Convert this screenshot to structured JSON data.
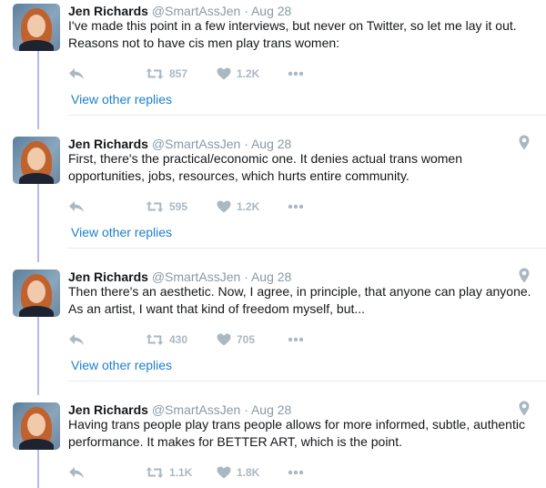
{
  "tweets": [
    {
      "name": "Jen Richards",
      "handle": "@SmartAssJen",
      "date": "· Aug 28",
      "text": "I've made this point in a few interviews, but never on Twitter, so let me lay it out. Reasons not to have cis men play trans women:",
      "retweets": "857",
      "likes": "1.2K",
      "view_replies": "View other replies",
      "location_icon": false
    },
    {
      "name": "Jen Richards",
      "handle": "@SmartAssJen",
      "date": "· Aug 28",
      "text": "First, there's the practical/economic one. It denies actual trans women opportunities, jobs, resources, which hurts entire community.",
      "retweets": "595",
      "likes": "1.2K",
      "view_replies": "View other replies",
      "location_icon": true
    },
    {
      "name": "Jen Richards",
      "handle": "@SmartAssJen",
      "date": "· Aug 28",
      "text": "Then there's an aesthetic. Now, I agree, in principle, that anyone can play anyone. As an artist, I want that kind of freedom myself, but...",
      "retweets": "430",
      "likes": "705",
      "view_replies": "View other replies",
      "location_icon": true
    },
    {
      "name": "Jen Richards",
      "handle": "@SmartAssJen",
      "date": "· Aug 28",
      "text": "Having trans people play trans people allows for more informed, subtle, authentic performance. It makes for BETTER ART, which is the point.",
      "retweets": "1.1K",
      "likes": "1.8K",
      "location_icon": true
    }
  ],
  "icons": {
    "reply": "reply-icon",
    "retweet": "retweet-icon",
    "like": "heart-icon",
    "more": "more-icon",
    "location": "location-pin-icon"
  },
  "colors": {
    "link": "#1b7fcc",
    "meta": "#8899a6",
    "action": "#aab8c2",
    "thread_line": "#b5b9f0"
  }
}
